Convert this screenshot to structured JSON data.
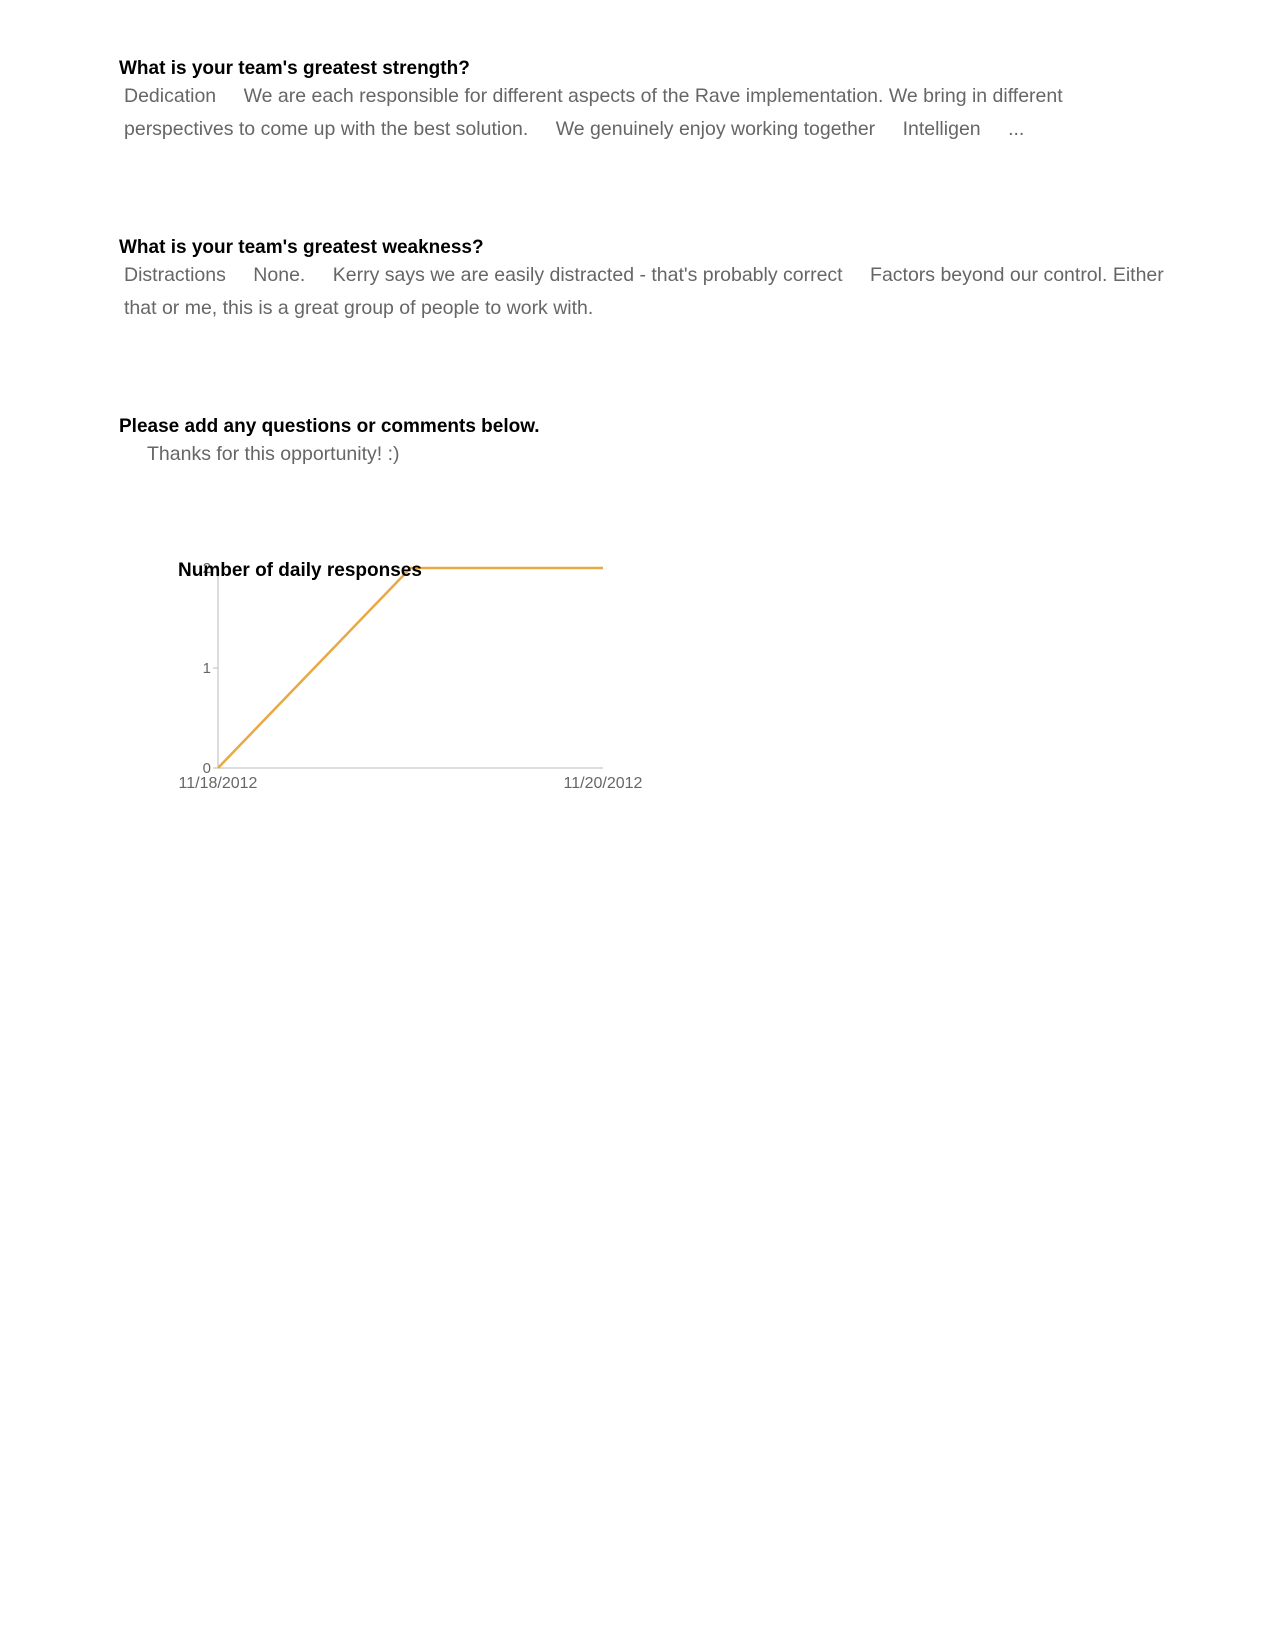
{
  "questions": [
    {
      "title": "What is your team's greatest strength?",
      "responses": [
        "Dedication",
        "We are each responsible for different aspects of the Rave implementation. We bring in different perspectives to come up with the best solution.",
        "We genuinely enjoy working together",
        "Intelligen",
        "..."
      ]
    },
    {
      "title": "What is your team's greatest weakness?",
      "responses": [
        "Distractions",
        "None.",
        "Kerry says we are easily distracted - that's probably correct",
        "Factors beyond our control. Either that or me, this is a great group of people to work with."
      ]
    },
    {
      "title": "Please add any questions or comments below.",
      "responses": [
        "Thanks for this opportunity! :)"
      ]
    }
  ],
  "colors": {
    "line": "#e8a945",
    "axis": "#bbbbbb",
    "tick_text": "#666666"
  },
  "chart_data": {
    "type": "line",
    "title": "Number of daily responses",
    "xlabel": "",
    "ylabel": "",
    "x": [
      "11/18/2012",
      "11/19/2012",
      "11/20/2012"
    ],
    "x_tick_labels": [
      "11/18/2012",
      "11/20/2012"
    ],
    "series": [
      {
        "values": [
          0,
          2,
          2
        ]
      }
    ],
    "ylim": [
      0,
      2
    ],
    "y_ticks": [
      "0",
      "1",
      "2"
    ],
    "grid": false,
    "legend": "none"
  }
}
